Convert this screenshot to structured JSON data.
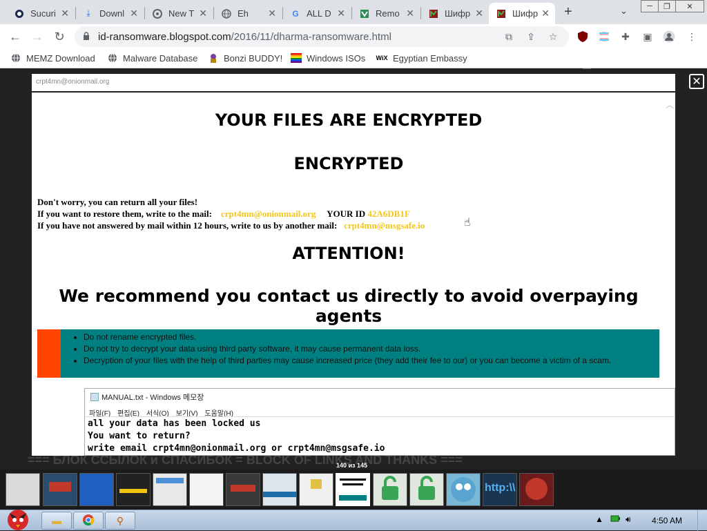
{
  "browser": {
    "tabs": [
      {
        "label": "Sucuri",
        "icon": "sucuri-icon"
      },
      {
        "label": "Downl",
        "icon": "download-icon"
      },
      {
        "label": "New T",
        "icon": "chrome-icon"
      },
      {
        "label": "Eh",
        "icon": "globe-icon"
      },
      {
        "label": "ALL D",
        "icon": "google-icon"
      },
      {
        "label": "Remo",
        "icon": "remove-icon"
      },
      {
        "label": "Шифр",
        "icon": "blogger-icon"
      },
      {
        "label": "Шифр",
        "icon": "blogger-icon"
      }
    ],
    "active_tab_index": 7,
    "url_host": "id-ransomware.blogspot.com",
    "url_path": "/2016/11/dharma-ransomware.html",
    "extension_badge": "8",
    "bookmarks": [
      {
        "label": "MEMZ Download",
        "icon": "globe-icon"
      },
      {
        "label": "Malware Database",
        "icon": "globe-icon"
      },
      {
        "label": "Bonzi BUDDY!",
        "icon": "bonzi-icon"
      },
      {
        "label": "Windows ISOs",
        "icon": "rainbow-flag-icon"
      },
      {
        "label": "Egyptian Embassy",
        "icon": "wix-icon"
      }
    ]
  },
  "page": {
    "background_heading": "=== БЛОК ССЫЛОК и СПАСИБОК = BLOCK OF LINKS AND THANKS ==="
  },
  "lightbox": {
    "caption": "crpt4mn@onionmail.org",
    "note": {
      "title1": "YOUR FILES ARE ENCRYPTED",
      "title2": "ENCRYPTED",
      "line1": "Don't worry, you can return all your files!",
      "line2_prefix": "If you want to restore them, write to the mail:",
      "email1": "crpt4mn@onionmail.org",
      "id_label": "YOUR ID",
      "id_value": "42A6DB1F",
      "line3_prefix": "If you have not answered by mail within 12 hours, write to us by another mail:",
      "email2": "crpt4mn@msgsafe.io",
      "attention": "ATTENTION!",
      "recommend": "We recommend you contact us directly to avoid overpaying agents",
      "tips": [
        "Do not rename encrypted files.",
        "Do not try to decrypt your data using third party software, it may cause permanent data loss.",
        "Decryption of your files with the help of third parties may cause increased price (they add their fee to our) or you can become a victim of a scam."
      ]
    },
    "notepad": {
      "title": "MANUAL.txt - Windows 메모장",
      "menu": [
        "파일(F)",
        "편집(E)",
        "서식(O)",
        "보기(V)",
        "도움말(H)"
      ],
      "lines": [
        "all your data has been locked us",
        "You want to return?",
        "write email crpt4mn@onionmail.org or crpt4mn@msgsafe.io"
      ]
    }
  },
  "gallery": {
    "counter": "140 из 145",
    "active_index": 9
  },
  "taskbar": {
    "clock": "4:50 AM"
  },
  "colors": {
    "note_email": "#f5c518",
    "tip_box": "#008080",
    "tip_accent": "#ff4500"
  }
}
